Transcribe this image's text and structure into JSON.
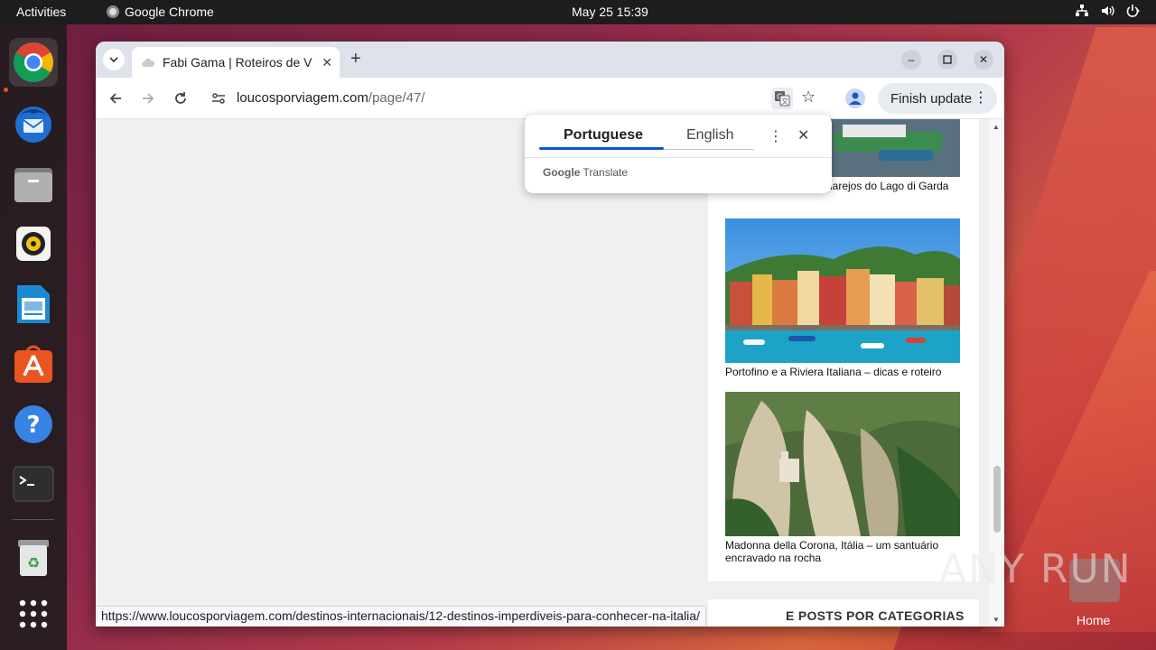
{
  "topbar": {
    "activities": "Activities",
    "app_name": "Google Chrome",
    "clock": "May 25  15:39"
  },
  "dock": {
    "items": [
      {
        "name": "chrome-icon"
      },
      {
        "name": "thunderbird-icon"
      },
      {
        "name": "files-icon"
      },
      {
        "name": "rhythmbox-icon"
      },
      {
        "name": "writer-icon"
      },
      {
        "name": "app-center-icon"
      },
      {
        "name": "help-icon"
      },
      {
        "name": "terminal-icon"
      },
      {
        "name": "trash-icon"
      },
      {
        "name": "app-grid-icon"
      }
    ]
  },
  "browser": {
    "tab_title": "Fabi Gama | Roteiros de V",
    "url_domain": "loucosporviagem.com",
    "url_path": "/page/47/",
    "finish_update": "Finish update",
    "status_url": "https://www.loucosporviagem.com/destinos-internacionais/12-destinos-imperdiveis-para-conhecer-na-italia/"
  },
  "translate_popup": {
    "lang_source": "Portuguese",
    "lang_target": "English",
    "brand_google": "Google",
    "brand_translate": "Translate"
  },
  "posts": [
    {
      "caption": "s vilarejos do Lago di Garda"
    },
    {
      "caption": "Portofino e a Riviera Italiana – dicas e roteiro"
    },
    {
      "caption": "Madonna della Corona, Itália – um santuário encravado na rocha"
    }
  ],
  "section_heading": "E POSTS POR CATEGORIAS",
  "desktop": {
    "home_label": "Home",
    "watermark": "ANY RUN"
  },
  "colors": {
    "accent": "#0b57d0",
    "ubuntu_orange": "#e95420"
  }
}
